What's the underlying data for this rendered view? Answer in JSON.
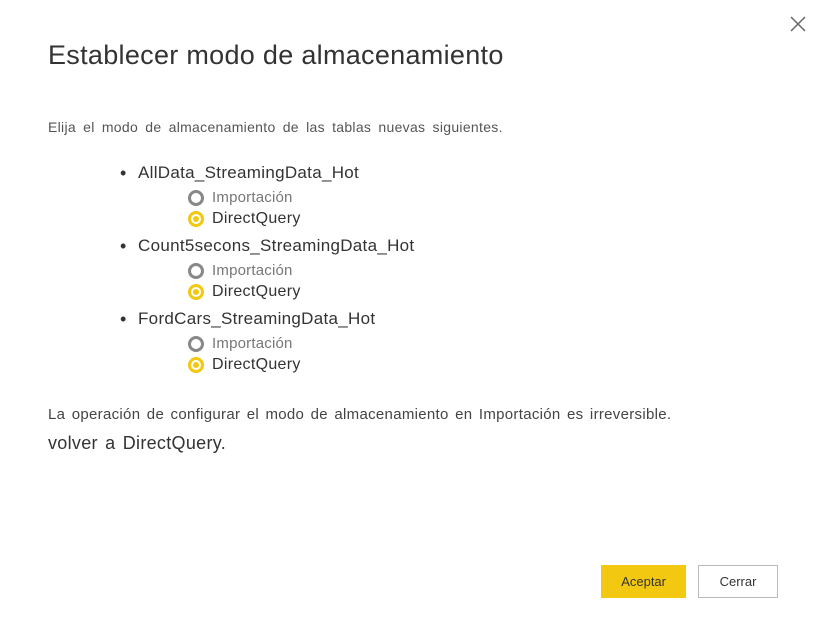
{
  "dialog": {
    "title": "Establecer modo de almacenamiento",
    "instruction": "Elija el modo de almacenamiento de las tablas nuevas siguientes.",
    "warning_line1": "La operación de configurar el modo de almacenamiento en Importación es irreversible.",
    "warning_line2": "volver a DirectQuery."
  },
  "tables": [
    {
      "name": "AllData_StreamingData_Hot",
      "options": {
        "import": "Importación",
        "directquery": "DirectQuery"
      },
      "selected": "directquery"
    },
    {
      "name": "Count5secons_StreamingData_Hot",
      "options": {
        "import": "Importación",
        "directquery": "DirectQuery"
      },
      "selected": "directquery"
    },
    {
      "name": "FordCars_StreamingData_Hot",
      "options": {
        "import": "Importación",
        "directquery": "DirectQuery"
      },
      "selected": "directquery"
    }
  ],
  "buttons": {
    "accept": "Aceptar",
    "close": "Cerrar"
  }
}
